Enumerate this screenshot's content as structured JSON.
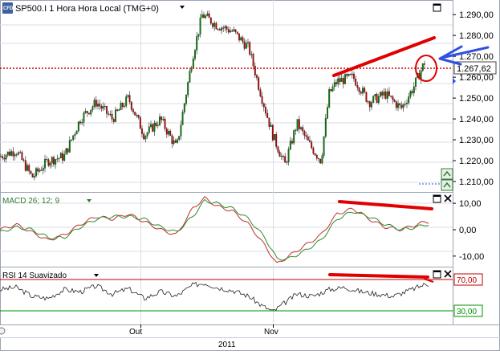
{
  "price_panel": {
    "symbol": "SP500.I",
    "timeframe": "1 Hora",
    "timezone": "Hora Local (TMG+0)",
    "current_price": "1.267,62",
    "axis_ticks": [
      "1.290,00",
      "1.280,00",
      "1.270,00",
      "1.260,00",
      "1.250,00",
      "1.240,00",
      "1.230,00",
      "1.220,00",
      "1.210,00"
    ],
    "logo_text": "CFD",
    "up_color": "#008000",
    "down_color": "#c00000",
    "resistance_color": "#d00000"
  },
  "macd_panel": {
    "title": "MACD 26; 12; 9",
    "axis_ticks": [
      "10,00",
      "0,00",
      "-10,00"
    ],
    "macd_color": "#c03030",
    "signal_color": "#2e8b2e"
  },
  "rsi_panel": {
    "title": "RSI 14 Suavizado",
    "axis_ticks": [
      "70,00",
      "30,00"
    ],
    "upper_color": "#c00000",
    "lower_color": "#009000"
  },
  "time_axis": {
    "months": [
      "Out",
      "Nov"
    ],
    "year": "2011"
  },
  "annotations": {
    "color": "#e00000",
    "arrow_color": "#3050e0"
  },
  "chart_data": [
    {
      "type": "candlestick",
      "title": "SP500.I 1 Hora Hora Local (TMG+0)",
      "ylim": [
        1205,
        1297
      ],
      "x_labels": [
        "Out",
        "Nov"
      ],
      "current_price": 1267.62,
      "x": [
        0,
        20,
        40,
        60,
        80,
        100,
        120,
        140,
        160,
        180,
        200,
        220,
        240,
        252,
        270,
        290,
        310,
        325,
        340,
        355,
        370,
        385,
        400,
        410,
        420,
        440,
        460,
        480,
        500,
        515,
        530
      ],
      "close": [
        1222,
        1225,
        1212,
        1220,
        1222,
        1240,
        1248,
        1240,
        1250,
        1232,
        1240,
        1226,
        1270,
        1290,
        1285,
        1282,
        1274,
        1252,
        1232,
        1218,
        1238,
        1228,
        1220,
        1252,
        1258,
        1260,
        1248,
        1252,
        1245,
        1255,
        1268
      ]
    },
    {
      "type": "line",
      "title": "MACD 26; 12; 9",
      "ylim": [
        -14,
        14
      ],
      "x": [
        0,
        20,
        40,
        60,
        80,
        100,
        120,
        140,
        160,
        180,
        200,
        220,
        240,
        255,
        270,
        290,
        310,
        330,
        345,
        360,
        380,
        400,
        420,
        440,
        460,
        480,
        500,
        520,
        530
      ],
      "series": [
        {
          "values": [
            0,
            2,
            -1,
            -4,
            -2,
            2,
            5,
            4,
            6,
            3,
            0,
            -2,
            8,
            12,
            9,
            7,
            2,
            -6,
            -13,
            -10,
            -6,
            -2,
            6,
            8,
            4,
            1,
            0,
            2,
            3
          ]
        },
        {
          "values": [
            -1,
            1,
            0,
            -3,
            -3,
            1,
            4,
            5,
            5,
            4,
            1,
            -1,
            5,
            11,
            10,
            8,
            4,
            -3,
            -11,
            -11,
            -8,
            -4,
            4,
            7,
            5,
            2,
            0,
            1,
            2
          ]
        }
      ]
    },
    {
      "type": "line",
      "title": "RSI 14 Suavizado",
      "ylim": [
        0,
        100
      ],
      "reference_lines": [
        70,
        30
      ],
      "x": [
        0,
        20,
        40,
        60,
        80,
        100,
        120,
        140,
        160,
        180,
        200,
        220,
        240,
        255,
        270,
        290,
        310,
        325,
        340,
        355,
        370,
        390,
        410,
        430,
        450,
        470,
        490,
        510,
        530
      ],
      "series": [
        {
          "values": [
            60,
            65,
            45,
            40,
            60,
            55,
            68,
            50,
            62,
            40,
            55,
            45,
            70,
            75,
            65,
            58,
            45,
            25,
            10,
            30,
            50,
            45,
            60,
            65,
            55,
            50,
            45,
            58,
            72
          ]
        }
      ]
    }
  ]
}
